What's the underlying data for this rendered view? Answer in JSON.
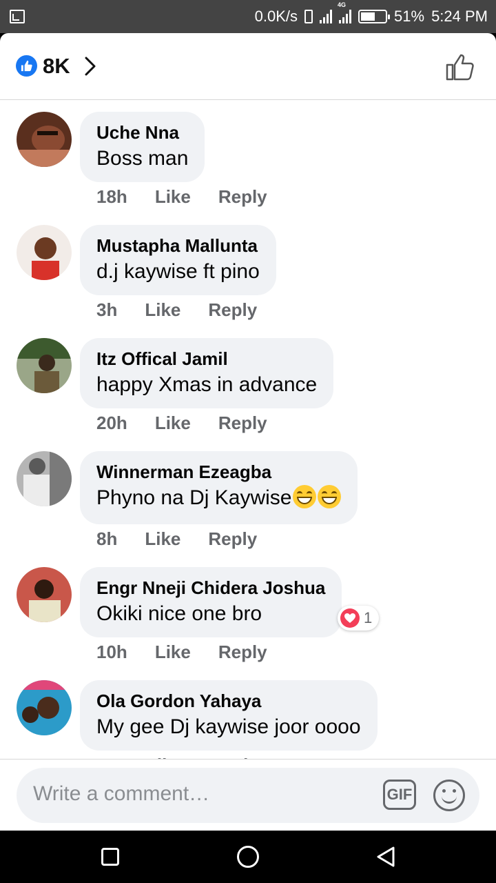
{
  "status_bar": {
    "net_speed": "0.0K/s",
    "network_type": "4G",
    "battery": "51%",
    "time": "5:24 PM",
    "icons": [
      "screen-cast-icon",
      "vibrate-icon",
      "signal-icon",
      "battery-icon"
    ]
  },
  "header": {
    "reaction_icon": "like-reaction-icon",
    "reaction_count": "8K",
    "chevron_icon": "chevron-right-icon",
    "like_button_icon": "thumbs-up-icon",
    "accent_color": "#1877f2"
  },
  "comments": [
    {
      "name": "Uche Nna",
      "text": "Boss man",
      "time": "18h",
      "like": "Like",
      "reply": "Reply",
      "avatar_color": "#5a2f1e"
    },
    {
      "name": "Mustapha Mallunta",
      "text": "d.j kaywise ft pino",
      "time": "3h",
      "like": "Like",
      "reply": "Reply",
      "avatar_color": "#b7443a"
    },
    {
      "name": "Itz Offical Jamil",
      "text": "happy Xmas in advance",
      "time": "20h",
      "like": "Like",
      "reply": "Reply",
      "avatar_color": "#6b7a4a"
    },
    {
      "name": "Winnerman Ezeagba",
      "text": "Phyno na Dj Kaywise",
      "emoji": "grinning-face-emoji",
      "time": "8h",
      "like": "Like",
      "reply": "Reply",
      "avatar_color": "#8c8c8c"
    },
    {
      "name": "Engr Nneji Chidera Joshua",
      "text": "Okiki nice one bro",
      "time": "10h",
      "like": "Like",
      "reply": "Reply",
      "reaction_icon": "love-reaction-icon",
      "reaction_count": "1",
      "avatar_color": "#a3522f"
    },
    {
      "name": "Ola Gordon Yahaya",
      "text": "My gee Dj kaywise joor oooo",
      "time": "",
      "like": "Like",
      "reply": "Reply",
      "avatar_color": "#2c9bc9"
    }
  ],
  "composer": {
    "placeholder": "Write a comment…",
    "gif_label": "GIF",
    "emoji_icon": "smiley-icon"
  },
  "nav_bar": {
    "icons": [
      "recent-apps-icon",
      "home-icon",
      "back-icon"
    ]
  }
}
